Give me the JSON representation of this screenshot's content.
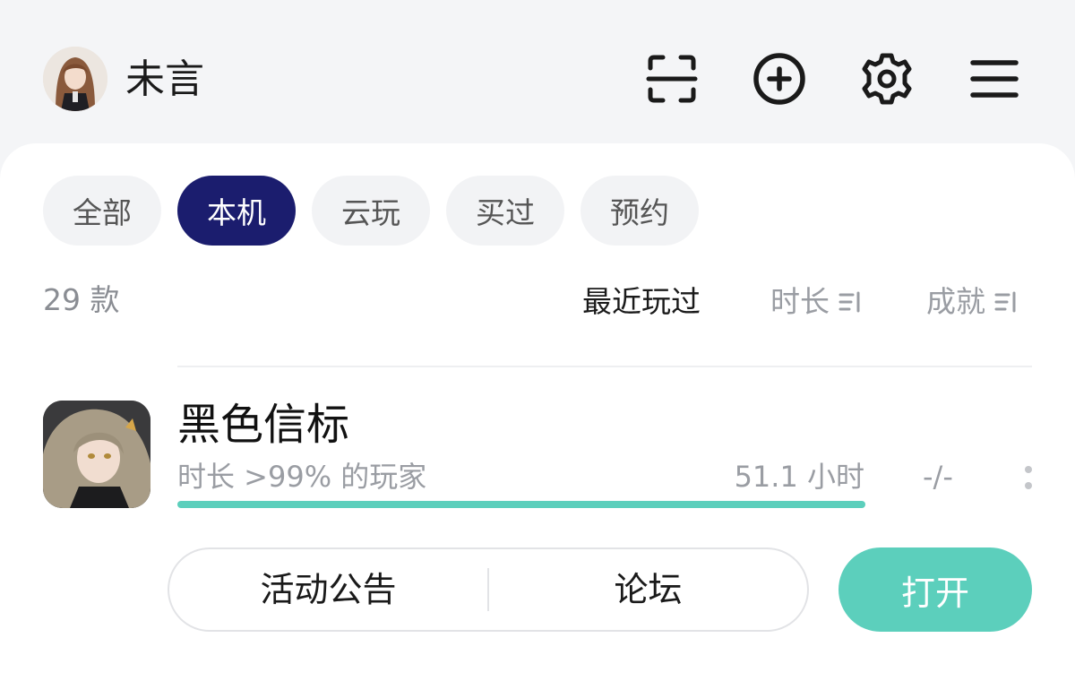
{
  "header": {
    "username": "未言",
    "icons": [
      "scan-icon",
      "add-circle-icon",
      "settings-gear-icon",
      "menu-icon"
    ]
  },
  "tabs": [
    {
      "label": "全部",
      "active": false
    },
    {
      "label": "本机",
      "active": true
    },
    {
      "label": "云玩",
      "active": false
    },
    {
      "label": "买过",
      "active": false
    },
    {
      "label": "预约",
      "active": false
    }
  ],
  "list": {
    "count_label": "29 款",
    "sort_options": [
      {
        "label": "最近玩过",
        "active": true
      },
      {
        "label": "时长",
        "active": false
      },
      {
        "label": "成就",
        "active": false
      }
    ]
  },
  "game": {
    "title": "黑色信标",
    "playtime_rank": "时长 >99% 的玩家",
    "hours": "51.1 小时",
    "achievements": "-/-",
    "progress_percent": 100,
    "actions": {
      "announcement": "活动公告",
      "forum": "论坛",
      "open": "打开"
    }
  },
  "colors": {
    "accent_teal": "#5ccfbc",
    "active_tab_navy": "#1b1d6e",
    "background": "#f4f5f7"
  }
}
